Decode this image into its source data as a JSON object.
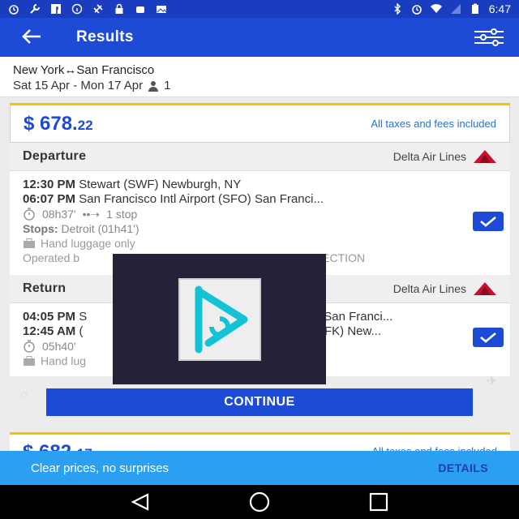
{
  "status_bar": {
    "time": "6:47",
    "icons": [
      "alarm-icon",
      "wrench-icon",
      "facebook-icon",
      "info-icon",
      "satellite-icon",
      "lock-icon",
      "android-icon",
      "photo-icon",
      "bluetooth-icon",
      "alarm-icon",
      "wifi-icon",
      "signal-icon",
      "battery-icon"
    ]
  },
  "app_bar": {
    "title": "Results",
    "back_icon": "arrow-left-icon",
    "filter_icon": "sliders-icon"
  },
  "route": {
    "origin": "New York",
    "arrow": "↔",
    "destination": "San Francisco",
    "dates": "Sat 15 Apr - Mon 17 Apr",
    "passengers": "1"
  },
  "result": {
    "price_main": "$ 678.",
    "price_cents": "22",
    "taxes_note": "All taxes and fees included",
    "departure": {
      "label": "Departure",
      "airline": "Delta Air Lines",
      "dep_time": "12:30 PM",
      "dep_place": "Stewart (SWF) Newburgh, NY",
      "arr_time": "06:07 PM",
      "arr_place": "San Francisco Intl Airport (SFO) San Franci...",
      "duration": "08h37'",
      "stops_count": "1 stop",
      "stops_label": "Stops:",
      "stops_detail": "Detroit (01h41')",
      "luggage": "Hand luggage only",
      "operated_prefix": "Operated b",
      "operated_suffix": "ONNECTION"
    },
    "return": {
      "label": "Return",
      "airline": "Delta Air Lines",
      "dep_time": "04:05 PM",
      "dep_place_start": "S",
      "dep_place_end": "FO) San Franci...",
      "arr_time": "12:45 AM",
      "arr_place_start": "(",
      "arr_place_end": "port (JFK) New...",
      "duration": "05h40'",
      "luggage": "Hand lug"
    }
  },
  "continue_label": "CONTINUE",
  "next_result": {
    "price_main": "$ 682.",
    "price_cents": "17",
    "taxes_note": "All taxes and fees included"
  },
  "banner": {
    "text": "Clear prices, no surprises",
    "link": "DETAILS"
  },
  "colors": {
    "primary": "#1e4bd6",
    "accent": "#f3c400",
    "banner": "#2b9ff2",
    "overlay": "#242238"
  }
}
